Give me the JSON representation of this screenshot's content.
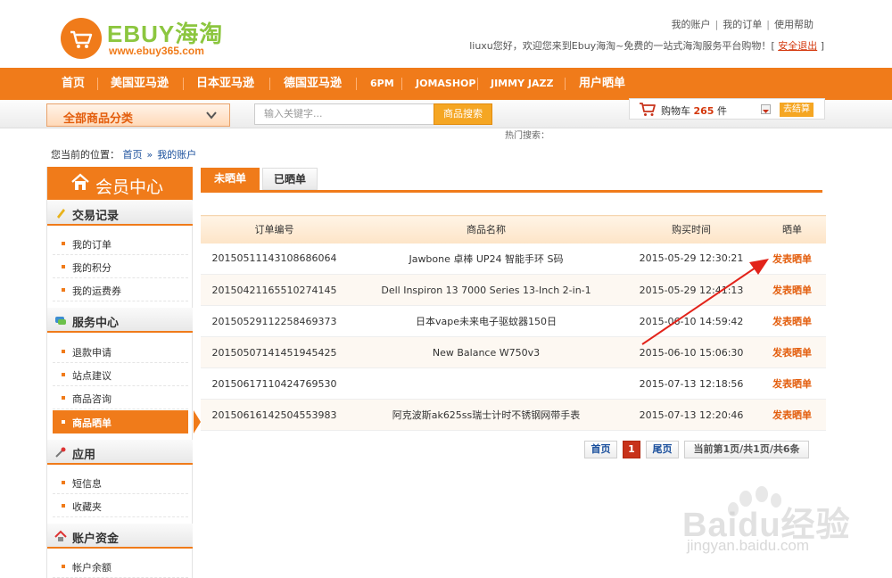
{
  "logo": {
    "brand": "EBUY海淘",
    "url": "www.ebuy365.com"
  },
  "top_links": [
    "我的账户",
    "我的订单",
    "使用帮助"
  ],
  "welcome": {
    "text": "liuxu您好，欢迎您来到Ebuy海淘~免费的一站式海淘服务平台购物！[",
    "logout": "安全退出",
    "close": "]"
  },
  "nav": [
    "首页",
    "美国亚马逊",
    "日本亚马逊",
    "德国亚马逊",
    "6PM",
    "JOMASHOP",
    "JIMMY JAZZ",
    "用户晒单"
  ],
  "category": {
    "label": "全部商品分类"
  },
  "search": {
    "placeholder": "输入关键字...",
    "button": "商品搜索",
    "hot": "热门搜索："
  },
  "cart": {
    "label_prefix": "购物车",
    "count": "265",
    "label_suffix": "件",
    "checkout": "去结算"
  },
  "breadcrumb": {
    "prefix": "您当前的位置：",
    "home": "首页",
    "arrow": "»",
    "current": "我的账户"
  },
  "sidebar": {
    "title": "会员中心",
    "sections": [
      {
        "label": "交易记录",
        "items": [
          "我的订单",
          "我的积分",
          "我的运费券"
        ]
      },
      {
        "label": "服务中心",
        "items": [
          "退款申请",
          "站点建议",
          "商品咨询",
          "商品晒单"
        ]
      },
      {
        "label": "应用",
        "items": [
          "短信息",
          "收藏夹"
        ]
      },
      {
        "label": "账户资金",
        "items": [
          "帐户余额"
        ]
      }
    ]
  },
  "tabs": [
    "未晒单",
    "已晒单"
  ],
  "table": {
    "headers": [
      "订单编号",
      "商品名称",
      "购买时间",
      "晒单"
    ],
    "rows": [
      {
        "order": "20150511143108686064",
        "name": "Jawbone 卓棒 UP24 智能手环 S码",
        "time": "2015-05-29 12:30:21",
        "action": "发表晒单"
      },
      {
        "order": "20150421165510274145",
        "name": "Dell Inspiron 13 7000 Series 13-Inch 2-in-1",
        "time": "2015-05-29 12:41:13",
        "action": "发表晒单"
      },
      {
        "order": "20150529112258469373",
        "name": "日本vape未来电子驱蚊器150日",
        "time": "2015-06-10 14:59:42",
        "action": "发表晒单"
      },
      {
        "order": "20150507141451945425",
        "name": "New Balance W750v3",
        "time": "2015-06-10 15:06:30",
        "action": "发表晒单"
      },
      {
        "order": "20150617110424769530",
        "name": "",
        "time": "2015-07-13 12:18:56",
        "action": "发表晒单"
      },
      {
        "order": "20150616142504553983",
        "name": "阿克波斯ak625ss瑞士计时不锈钢网带手表",
        "time": "2015-07-13 12:20:46",
        "action": "发表晒单"
      }
    ]
  },
  "pagination": {
    "first": "首页",
    "current": "1",
    "last": "尾页",
    "info": "当前第1页/共1页/共6条"
  },
  "watermark": {
    "text": "Baidu经验",
    "url": "jingyan.baidu.com"
  },
  "colors": {
    "accent": "#f07b1a",
    "link": "#1a4f9c",
    "action": "#e35d0c"
  }
}
